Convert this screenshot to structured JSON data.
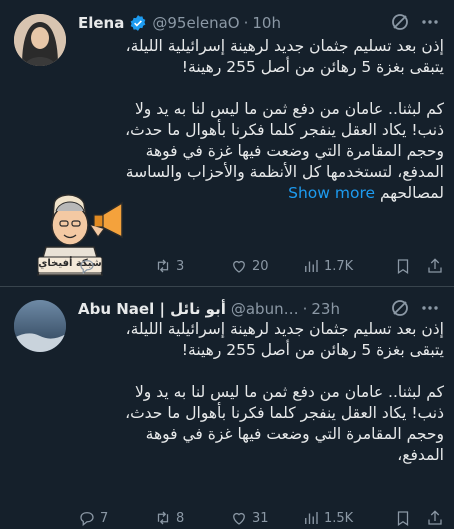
{
  "tweet1": {
    "name": "Elena",
    "handle": "@95elenaO",
    "separator": "·",
    "time": "10h",
    "body_p1": [
      "إذن بعد تسليم جثمان جديد لرهينة إسرائيلية الليلة،",
      "يتبقى بغزة 5 رهائن من أصل 255 رهينة!"
    ],
    "body_p2": [
      "كم لبثنا.. عامان من دفع ثمن ما ليس لنا به يد ولا",
      "ذنب! يكاد العقل ينفجر كلما فكرنا بأهوال ما حدث،",
      "وحجم المقامرة التي وضعت فيها غزة في فوهة",
      "المدفع، لتستخدمها كل الأنظمة والأحزاب والساسة"
    ],
    "body_last": "لمصالحهم",
    "show_more": "Show more",
    "cartoon_caption": "شبكة أفيخاي",
    "replies": "",
    "retweets": "3",
    "likes": "20",
    "views": "1.7K"
  },
  "tweet2": {
    "name": "Abu Nael | أبو نائل",
    "handle": "@abun…",
    "separator": "·",
    "time": "23h",
    "body_p1": [
      "إذن بعد تسليم جثمان جديد لرهينة إسرائيلية الليلة،",
      "يتبقى بغزة 5 رهائن من أصل 255 رهينة!"
    ],
    "body_p2": [
      "كم لبثنا.. عامان من دفع ثمن ما ليس لنا به يد ولا",
      "ذنب! يكاد العقل ينفجر كلما فكرنا بأهوال ما حدث،",
      "وحجم المقامرة التي وضعت فيها غزة في فوهة",
      "المدفع،"
    ],
    "replies": "7",
    "retweets": "8",
    "likes": "31",
    "views": "1.5K"
  },
  "colors": {
    "background": "#15202b",
    "text": "#e7e9ea",
    "muted": "#8b98a5",
    "accent": "#1d9bf0",
    "divider": "#38444d"
  },
  "icons": [
    "verified-badge-icon",
    "grok-icon",
    "more-icon",
    "reply-icon",
    "retweet-icon",
    "like-icon",
    "views-icon",
    "bookmark-icon",
    "share-icon"
  ]
}
